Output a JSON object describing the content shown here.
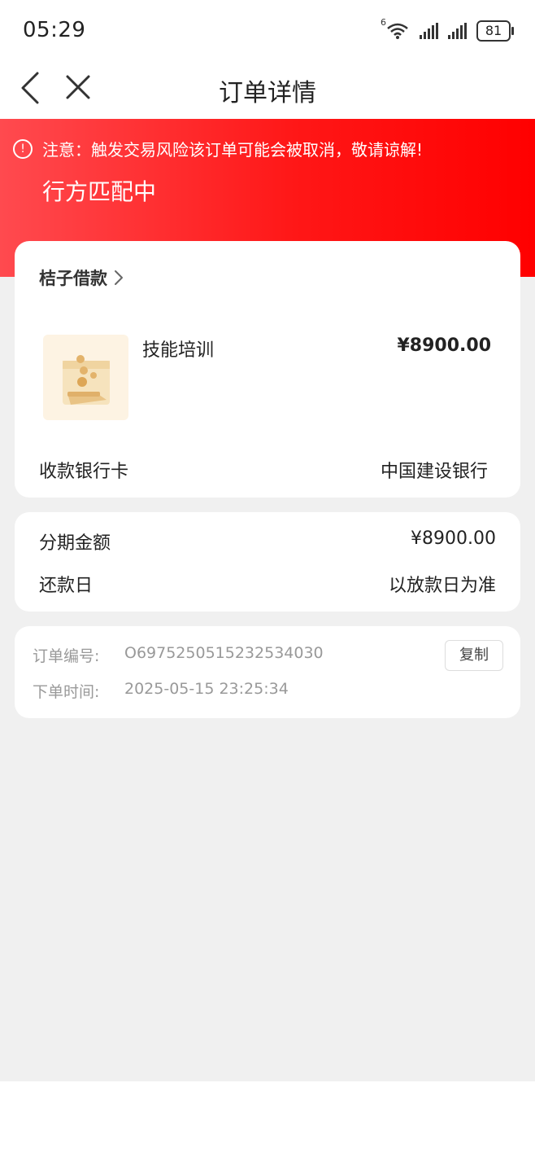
{
  "status_bar": {
    "time": "05:29",
    "network_label": "6",
    "battery": "81"
  },
  "nav": {
    "title": "订单详情",
    "back_icon": "chevron-left-icon",
    "close_icon": "close-icon"
  },
  "alert": {
    "icon": "exclamation-circle-icon",
    "text": "注意：触发交易风险该订单可能会被取消，敬请谅解!",
    "status": "行方匹配中"
  },
  "merchant_card": {
    "merchant": "桔子借款",
    "product_name": "技能培训",
    "price": "¥8900.00",
    "bank_label": "收款银行卡",
    "bank_value": "中国建设银行"
  },
  "installment": {
    "amount_label": "分期金额",
    "amount_value": "¥8900.00",
    "repay_label": "还款日",
    "repay_value": "以放款日为准"
  },
  "order_info": {
    "order_no_label": "订单编号:",
    "order_no": "O6975250515232534030",
    "copy_label": "复制",
    "time_label": "下单时间:",
    "time_value": "2025-05-15 23:25:34"
  },
  "colors": {
    "accent_red": "#ff1717",
    "background": "#f0f0f0"
  }
}
